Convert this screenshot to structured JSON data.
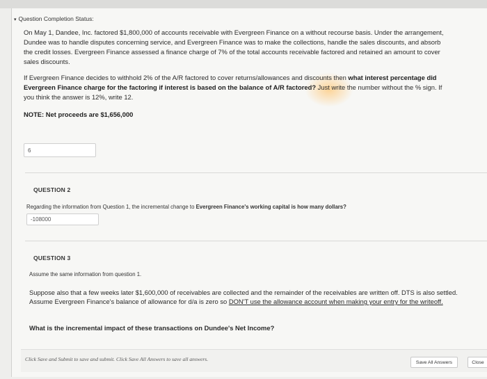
{
  "status": {
    "label": "Question Completion Status:"
  },
  "q1": {
    "paragraph1": "On May 1, Dandee, Inc. factored $1,800,000 of accounts receivable with Evergreen Finance on a without recourse basis. Under the arrangement, Dundee was to handle disputes concerning service, and Evergreen Finance was to make the collections, handle the sales discounts, and absorb the credit losses. Evergreen Finance assessed a finance charge of 7% of the total accounts receivable factored and retained an amount to cover sales discounts.",
    "p2_before": "If Evergreen Finance decides to withhold 2% of the A/R factored to cover returns/allowances and discounts then ",
    "p2_bold": "what interest percentage did Evergreen Finance charge for the factoring if interest is based on the balance of A/R factored?",
    "p2_after": " Just write the number without the % sign.  If you think the answer is 12%, write 12.",
    "note": "NOTE: Net proceeds are $1,656,000",
    "answer": "6"
  },
  "q2": {
    "heading": "QUESTION 2",
    "text_before": "Regarding the information from Question 1, the incremental change to ",
    "text_bold": "Evergreen Finance's working capital is how many dollars?",
    "answer": "-108000"
  },
  "q3": {
    "heading": "QUESTION 3",
    "intro": "Assume the same information from question 1.",
    "p_before": "Suppose also that a few weeks later $1,600,000 of receivables are collected and the remainder of the receivables are written off. DTS is also settled.  Assume Evergreen Finance's balance of allowance for d/a is zero so ",
    "p_underline": "DON'T use the allowance account when making your entry for the writeoff.",
    "question": "What is the incremental impact of these transactions on Dundee's Net Income?"
  },
  "footer": {
    "note": "Click Save and Submit to save and submit. Click Save All Answers to save all answers.",
    "save_all": "Save All Answers",
    "close": "Close"
  }
}
